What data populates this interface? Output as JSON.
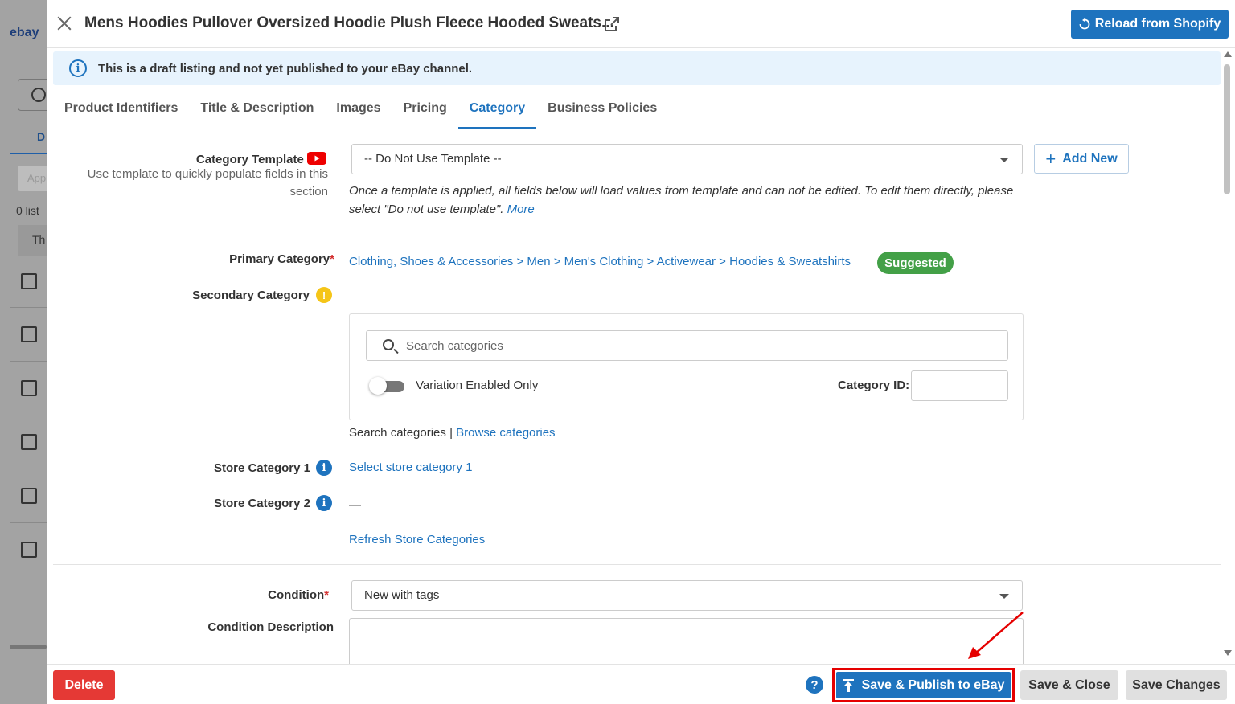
{
  "background_app": {
    "logo": "ebay",
    "tab": "D",
    "button": "App",
    "count": "0 list",
    "table_head": "Th"
  },
  "header": {
    "title": "Mens Hoodies Pullover Oversized Hoodie Plush Fleece Hooded Sweats...",
    "reload_label": "Reload from Shopify"
  },
  "info_bar": {
    "text": "This is a draft listing and not yet published to your eBay channel."
  },
  "tabs": [
    {
      "label": "Product Identifiers"
    },
    {
      "label": "Title & Description"
    },
    {
      "label": "Images"
    },
    {
      "label": "Pricing"
    },
    {
      "label": "Category"
    },
    {
      "label": "Business Policies"
    }
  ],
  "active_tab": "Category",
  "category_template": {
    "label": "Category Template",
    "help": "Use template to quickly populate fields in this section",
    "selected": "-- Do Not Use Template --",
    "add_new_label": "Add New",
    "note": "Once a template is applied, all fields below will load values from template and can not be edited. To edit them directly, please select \"Do not use template\".",
    "more_link": "More"
  },
  "primary_category": {
    "label": "Primary Category",
    "required_mark": "*",
    "path": "Clothing, Shoes & Accessories > Men > Men's Clothing > Activewear > Hoodies & Sweatshirts",
    "badge": "Suggested"
  },
  "secondary_category": {
    "label": "Secondary Category",
    "search_placeholder": "Search categories",
    "toggle_label": "Variation Enabled Only",
    "category_id_label": "Category ID:",
    "category_id_value": "",
    "search_link_text": "Search categories",
    "separator": "|",
    "browse_link": "Browse categories"
  },
  "store_category_1": {
    "label": "Store Category 1",
    "value": "Select store category 1"
  },
  "store_category_2": {
    "label": "Store Category 2",
    "value": "—"
  },
  "refresh_store_link": "Refresh Store Categories",
  "condition": {
    "label": "Condition",
    "required_mark": "*",
    "selected": "New with tags"
  },
  "condition_description": {
    "label": "Condition Description",
    "value": ""
  },
  "footer": {
    "delete_label": "Delete",
    "help_symbol": "?",
    "publish_label": "Save & Publish to eBay",
    "save_close_label": "Save & Close",
    "save_changes_label": "Save Changes"
  },
  "colors": {
    "primary_blue": "#1e73be",
    "danger_red": "#e53935",
    "suggested_green": "#43a047",
    "info_bg": "#e7f3fd",
    "annotation_red": "#e50000"
  }
}
